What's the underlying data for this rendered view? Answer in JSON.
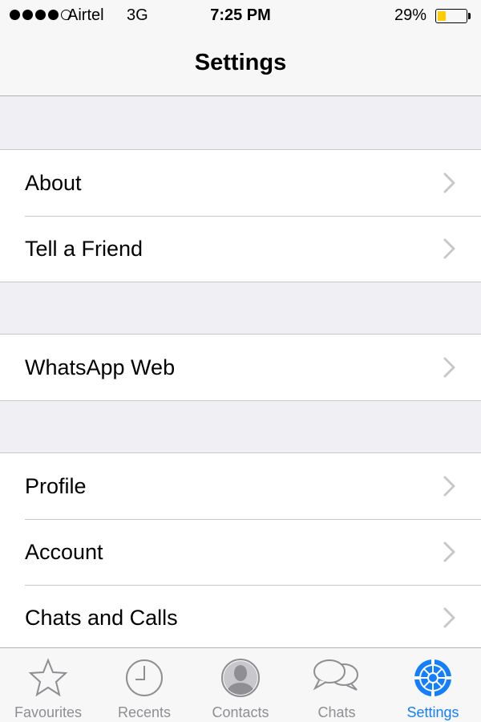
{
  "status_bar": {
    "signal_filled": 4,
    "signal_total": 5,
    "carrier": "Airtel",
    "network": "3G",
    "time": "7:25 PM",
    "battery_percent": "29%",
    "battery_level": 0.29,
    "battery_color": "#ffcc00"
  },
  "nav": {
    "title": "Settings"
  },
  "groups": [
    {
      "items": [
        {
          "label": "About"
        },
        {
          "label": "Tell a Friend"
        }
      ]
    },
    {
      "items": [
        {
          "label": "WhatsApp Web"
        }
      ]
    },
    {
      "items": [
        {
          "label": "Profile"
        },
        {
          "label": "Account"
        },
        {
          "label": "Chats and Calls"
        }
      ]
    }
  ],
  "tab_bar": {
    "active_color": "#157efb",
    "inactive_color": "#8e8e93",
    "tabs": [
      {
        "label": "Favourites",
        "icon": "star-icon",
        "active": false
      },
      {
        "label": "Recents",
        "icon": "clock-icon",
        "active": false
      },
      {
        "label": "Contacts",
        "icon": "person-icon",
        "active": false
      },
      {
        "label": "Chats",
        "icon": "chat-bubbles-icon",
        "active": false
      },
      {
        "label": "Settings",
        "icon": "gear-icon",
        "active": true
      }
    ]
  }
}
